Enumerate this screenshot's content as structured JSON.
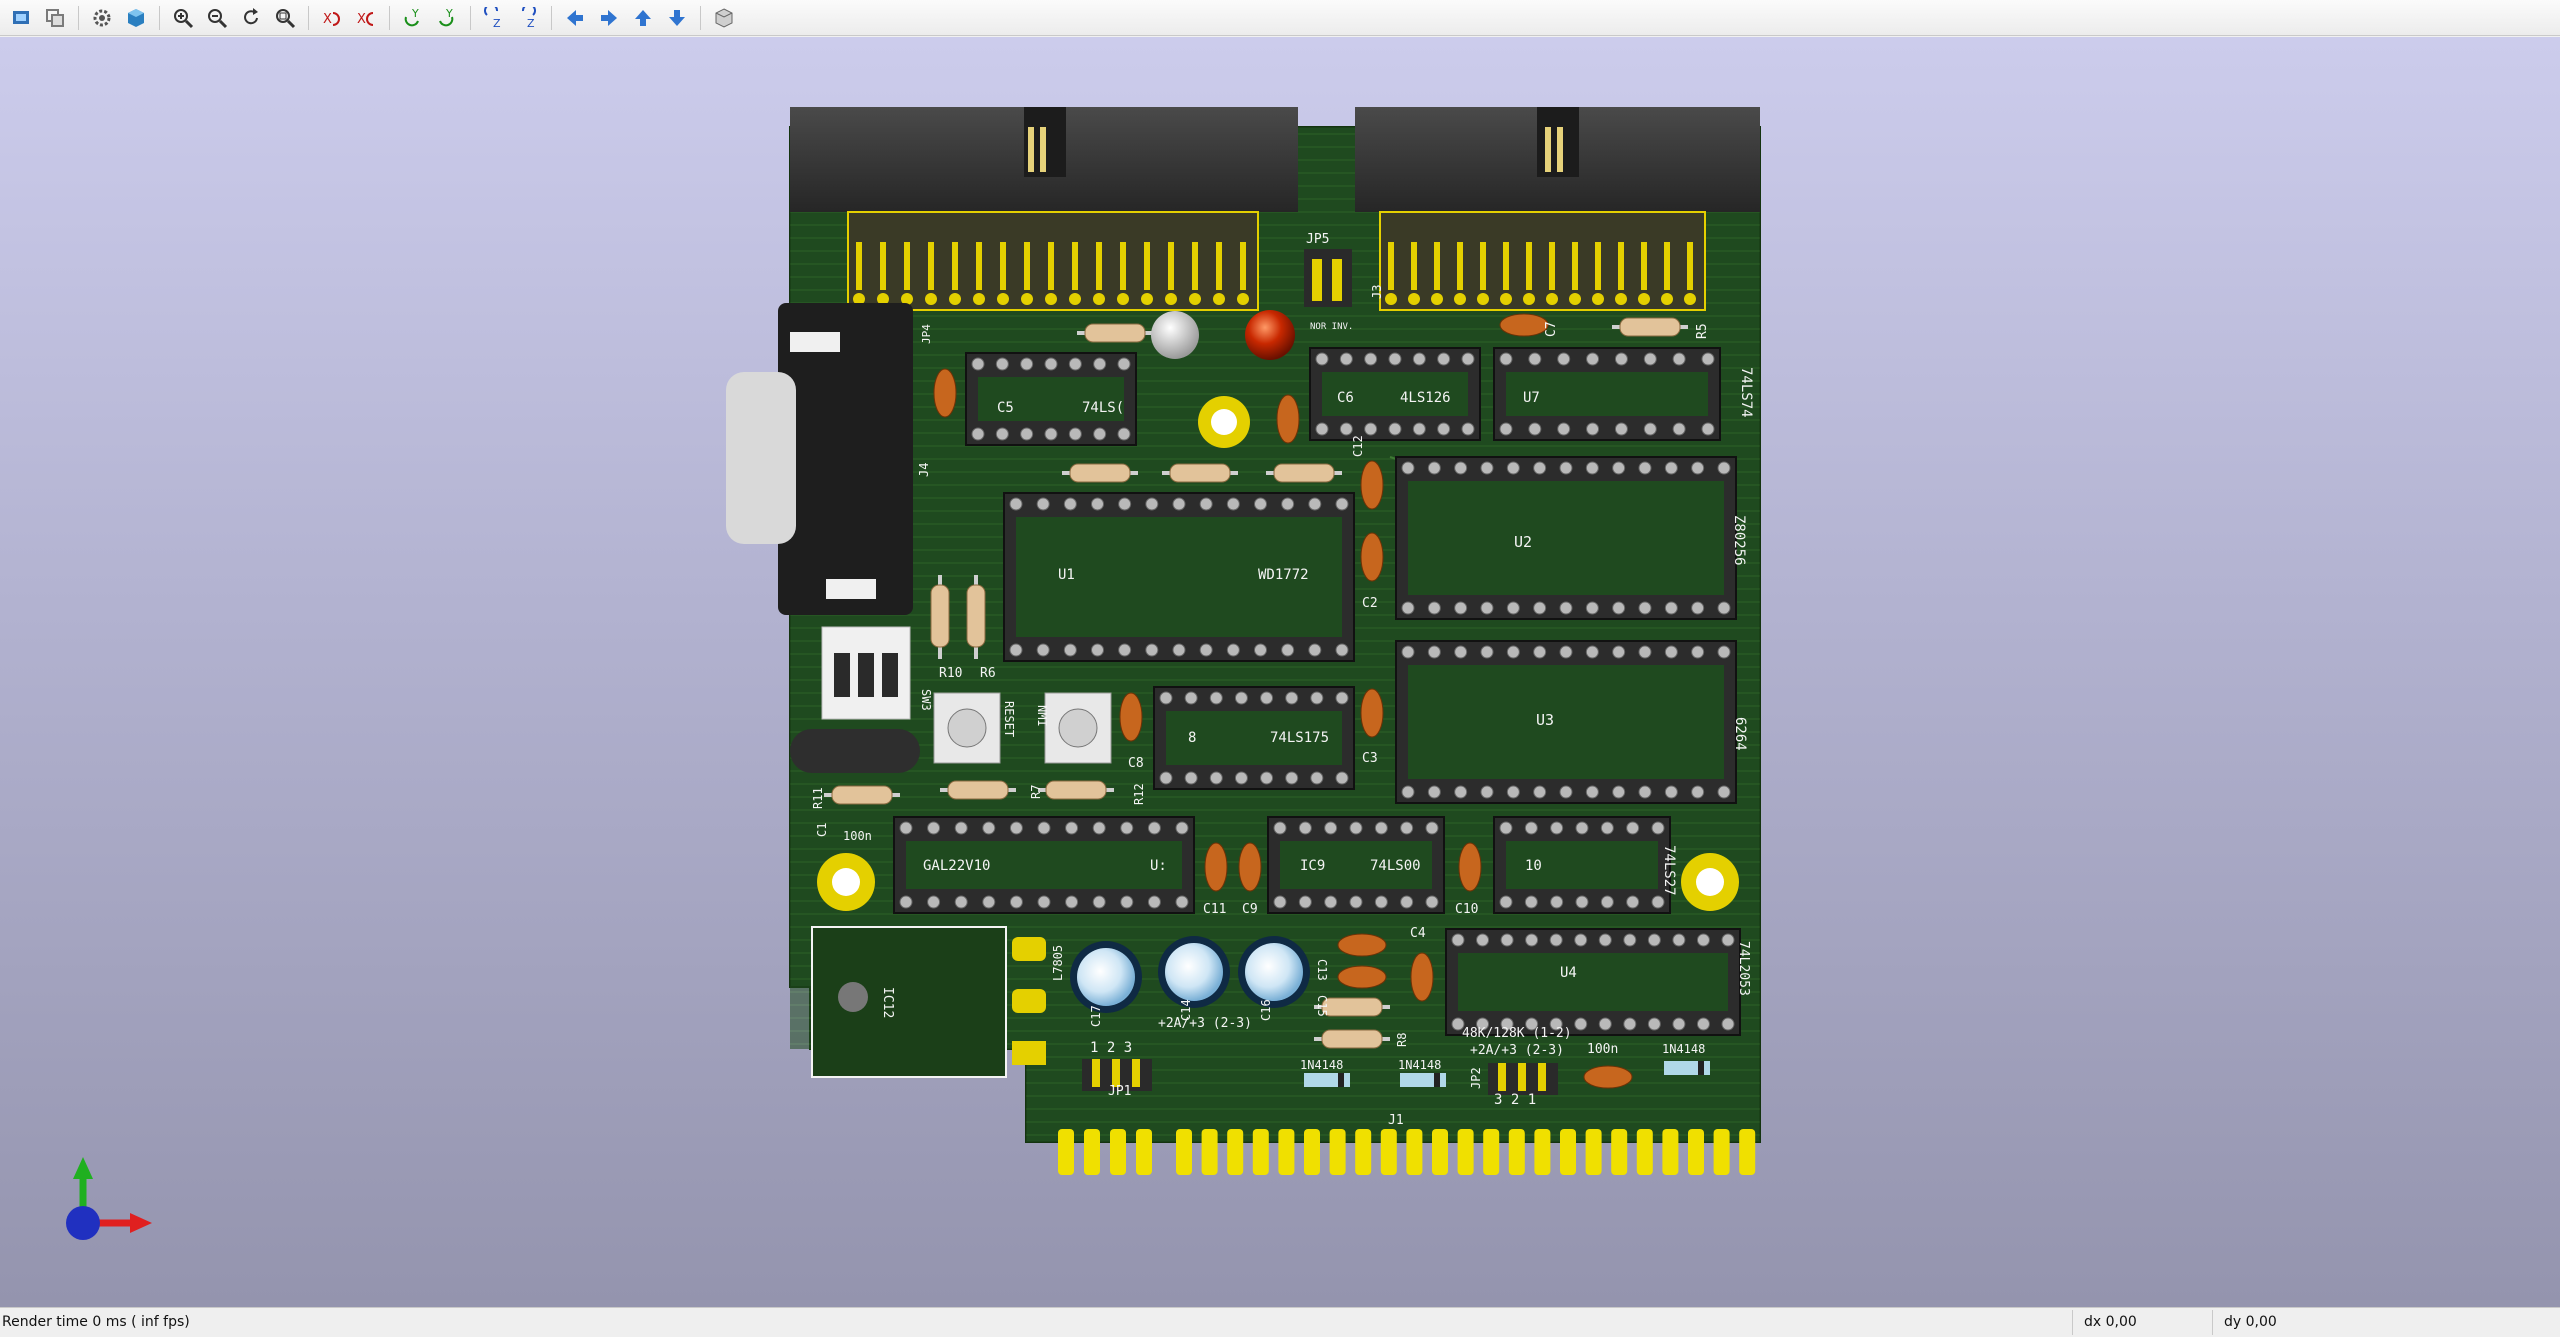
{
  "toolbar": {
    "buttons": [
      {
        "name": "render-raytrace-icon",
        "color": "#2f6fb5"
      },
      {
        "name": "copy-image-icon",
        "color": "#7a7a7a"
      },
      {
        "sep": true
      },
      {
        "name": "settings-icon",
        "color": "#555555"
      },
      {
        "name": "view-cube-icon",
        "color": "#2a7fc0"
      },
      {
        "sep": true
      },
      {
        "name": "zoom-in-icon",
        "color": "#333333"
      },
      {
        "name": "zoom-out-icon",
        "color": "#333333"
      },
      {
        "name": "redraw-icon",
        "color": "#333333"
      },
      {
        "name": "zoom-fit-icon",
        "color": "#333333"
      },
      {
        "sep": true
      },
      {
        "name": "rotate-x-cw-icon",
        "color": "#c01818"
      },
      {
        "name": "rotate-x-ccw-icon",
        "color": "#c01818"
      },
      {
        "sep": true
      },
      {
        "name": "rotate-y-cw-icon",
        "color": "#1a8f1a"
      },
      {
        "name": "rotate-y-ccw-icon",
        "color": "#1a8f1a"
      },
      {
        "sep": true
      },
      {
        "name": "rotate-z-cw-icon",
        "color": "#2050c0"
      },
      {
        "name": "rotate-z-ccw-icon",
        "color": "#2050c0"
      },
      {
        "sep": true
      },
      {
        "name": "pan-left-icon",
        "color": "#2f74d0"
      },
      {
        "name": "pan-right-icon",
        "color": "#2f74d0"
      },
      {
        "name": "pan-up-icon",
        "color": "#2f74d0"
      },
      {
        "name": "pan-down-icon",
        "color": "#2f74d0"
      },
      {
        "sep": true
      },
      {
        "name": "orthographic-icon",
        "color": "#666666"
      }
    ]
  },
  "board": {
    "colors": {
      "pcb": "#1f4a1f",
      "pcb_light": "#2b5a28",
      "trace": "#3b6e2e",
      "silkscreen": "#f4f4f4",
      "pad_gold": "#e4d000",
      "socket": "#2a2a2a",
      "connector": "#3a3a3a"
    },
    "labels": {
      "jp5": "JP5",
      "nor_inv": "NOR\nINV.",
      "jp4": "JP4",
      "j3": "J3",
      "c5": "C5",
      "ic_74ls_top": "74LS(",
      "c6": "C6",
      "ic_74ls126": "4LS126",
      "c7": "C7",
      "r5": "R5",
      "u7": "U7",
      "ic_74ls74": "74LS74",
      "j4": "J4",
      "c12": "C12",
      "u2": "U2",
      "z80256": "Z80256",
      "u1": "U1",
      "wd1772": "WD1772",
      "c2": "C2",
      "r10": "R10",
      "r6": "R6",
      "sw3": "SW3",
      "reset": "RESET",
      "nmi": "NMI",
      "u3": "U3",
      "ic_6264": "6264",
      "c8": "C8",
      "ic8": "8",
      "ic_74ls175": "74LS175",
      "c3": "C3",
      "r11": "R11",
      "r7": "R7",
      "r12": "R12",
      "c1": "C1",
      "val_100n": "100n",
      "gal22v10": "GAL22V10",
      "u_gal": "U:",
      "c11": "C11",
      "c9": "C9",
      "ic9": "IC9",
      "ic_74ls00": "74LS00",
      "c10": "C10",
      "ic10": "10",
      "ic_74ls27": "74LS27",
      "c4": "C4",
      "c13": "C13",
      "c15": "C15",
      "u4": "U4",
      "ic_74l2053": "74L2053",
      "ic12": "IC12",
      "l7805": "L7805",
      "c17": "C17",
      "c14": "C14",
      "c16": "C16",
      "r8": "R8",
      "jp_opt": "+2A/+3 (2-3)",
      "mem_opt": "48K/128K (1-2)",
      "mem_opt2": "+2A/+3 (2-3)",
      "val_100n_b": "100n",
      "pins_123": "1  2  3",
      "jp1": "JP1",
      "d_1n4148_a": "1N4148",
      "d_1n4148_b": "1N4148",
      "d_1n4148_c": "1N4148",
      "jp2": "JP2",
      "pins_321": "3  2  1",
      "j1": "J1"
    }
  },
  "axes": {
    "x_color": "#e02020",
    "y_color": "#20b020",
    "z_color": "#2030c0"
  },
  "status": {
    "render_time": "Render time 0 ms ( inf fps)",
    "dx": "dx 0,00",
    "dy": "dy 0,00"
  }
}
